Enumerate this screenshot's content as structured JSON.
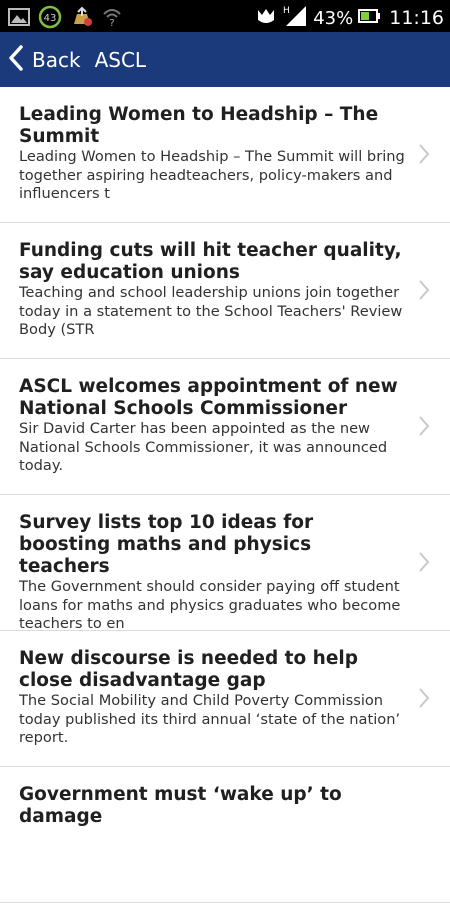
{
  "status_bar": {
    "battery_percent": "43%",
    "time": "11:16",
    "notification_count": "43",
    "icons": [
      "image-icon",
      "circle-43-icon",
      "upload-icon",
      "wifi-question-icon",
      "gesture-icon",
      "signal-icon",
      "battery-icon"
    ]
  },
  "action_bar": {
    "back_label": "Back",
    "title": "ASCL",
    "color": "#1a3a7c"
  },
  "articles": [
    {
      "title": "Leading Women to Headship – The Summit",
      "summary": "Leading Women to Headship – The Summit will bring together aspiring headteachers, policy-makers and influencers t"
    },
    {
      "title": "Funding cuts will hit teacher quality, say education unions",
      "summary": "Teaching and school leadership unions join together today in a statement to the School Teachers' Review Body (STR"
    },
    {
      "title": "ASCL welcomes appointment of new National Schools Commissioner",
      "summary": "Sir David Carter has been appointed as the new National Schools Commissioner, it was announced today."
    },
    {
      "title": "Survey lists top 10 ideas for boosting maths and physics teachers",
      "summary": "The Government should consider paying off student loans for maths and physics graduates who become teachers to en"
    },
    {
      "title": "New discourse is needed to help close disadvantage gap",
      "summary": "The Social Mobility and Child Poverty Commission today published its third annual ‘state of the nation’ report."
    },
    {
      "title": "Government must ‘wake up’ to damage",
      "summary": ""
    }
  ]
}
